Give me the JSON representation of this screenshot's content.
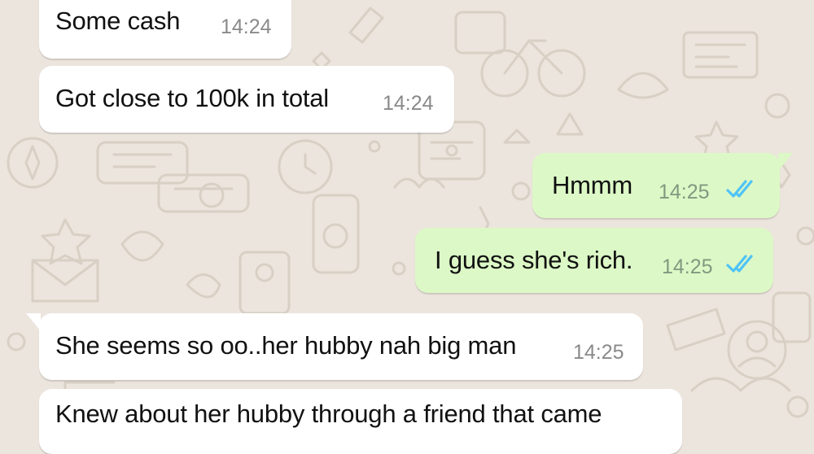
{
  "messages": [
    {
      "direction": "incoming",
      "text": "Some cash",
      "time": "14:24"
    },
    {
      "direction": "incoming",
      "text": "Got close to 100k in total",
      "time": "14:24"
    },
    {
      "direction": "outgoing",
      "text": "Hmmm",
      "time": "14:25",
      "status": "read"
    },
    {
      "direction": "outgoing",
      "text": "I guess she's rich.",
      "time": "14:25",
      "status": "read"
    },
    {
      "direction": "incoming",
      "text": "She seems so oo..her hubby nah big man",
      "time": "14:25"
    },
    {
      "direction": "incoming",
      "text": "Knew about her hubby through a friend that came",
      "time": ""
    }
  ],
  "colors": {
    "background": "#ece5dd",
    "incoming_bubble": "#ffffff",
    "outgoing_bubble": "#dcf8c6",
    "read_ticks": "#4fc3f7"
  },
  "icons": {
    "read_receipt": "double-check-icon"
  }
}
